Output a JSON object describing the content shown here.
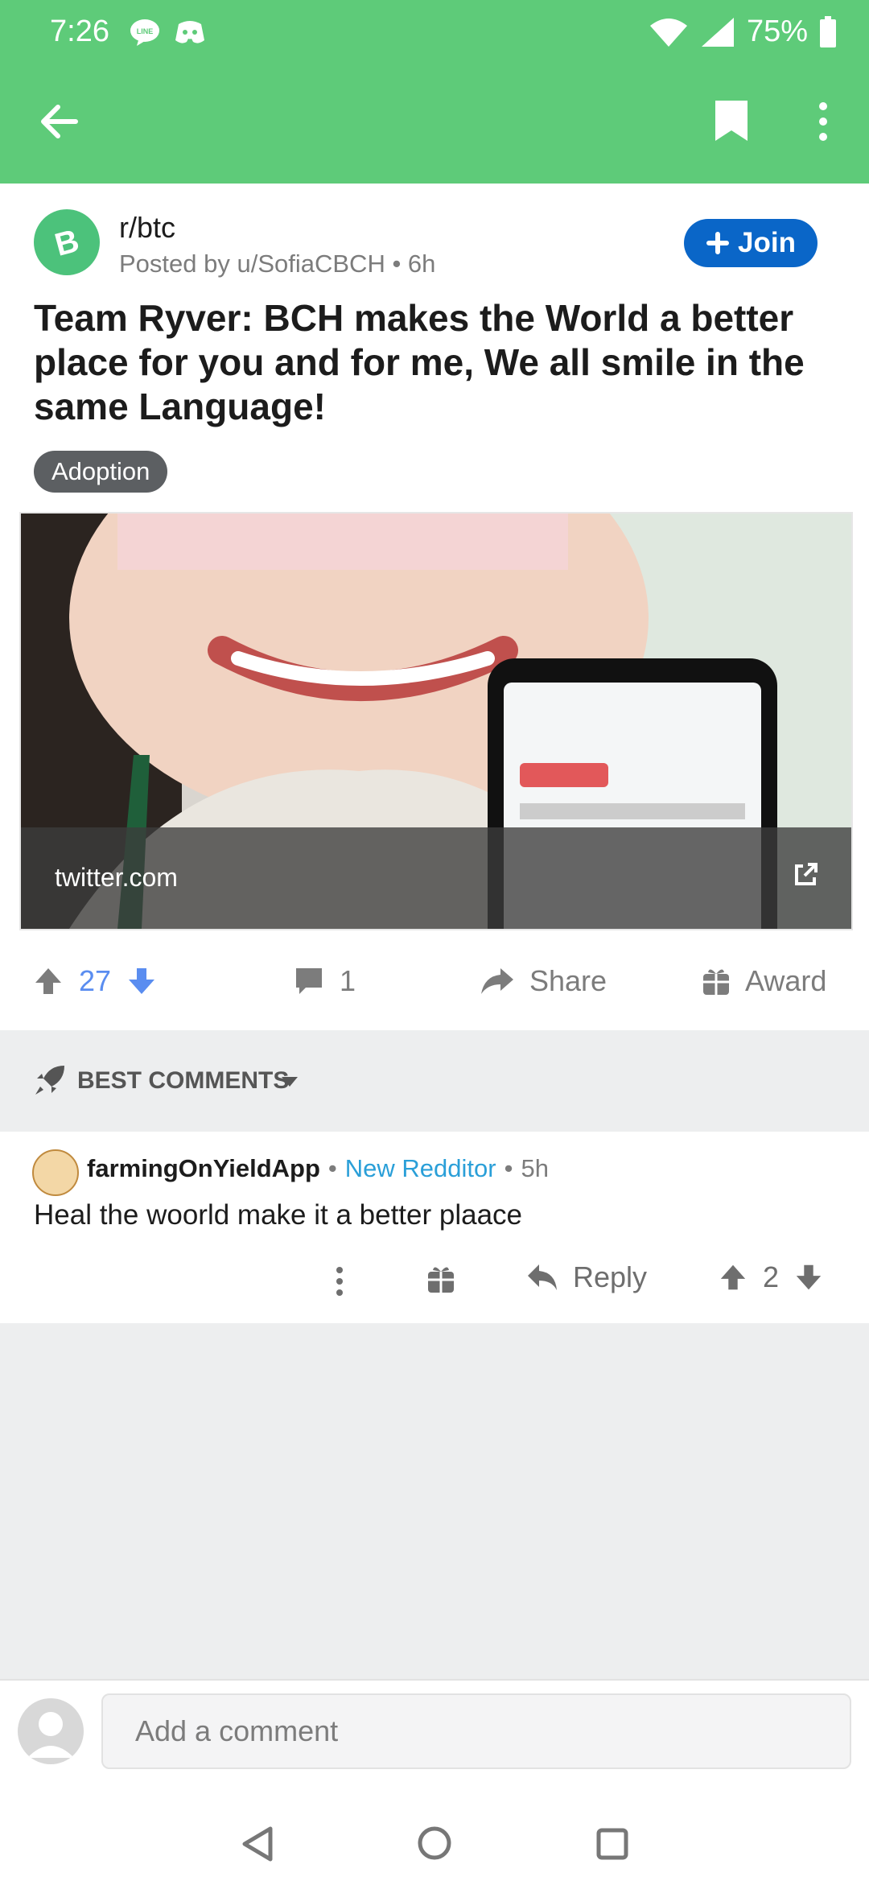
{
  "status_bar": {
    "time": "7:26",
    "battery": "75%",
    "icons": [
      "line-icon",
      "discord-icon",
      "wifi-icon",
      "signal-icon",
      "battery-icon"
    ]
  },
  "app_bar": {
    "icons": [
      "back-arrow-icon",
      "bookmark-icon",
      "more-vert-icon"
    ],
    "color": "#5ecb79"
  },
  "post": {
    "subreddit": "r/btc",
    "posted_by": "Posted by u/SofiaCBCH • 6h",
    "join_label": "Join",
    "title": "Team Ryver: BCH makes the World a better place for you and for me, We all smile in the same Language!",
    "flair": "Adoption",
    "link_domain": "twitter.com",
    "votes": "27",
    "comments": "1",
    "share_label": "Share",
    "award_label": "Award"
  },
  "comments_section": {
    "sort_label": "BEST COMMENTS"
  },
  "comment": {
    "username": "farmingOnYieldApp",
    "user_flair": "New Redditor",
    "time": "5h",
    "body": "Heal the woorld make it a better plaace",
    "reply_label": "Reply",
    "votes": "2"
  },
  "composer": {
    "placeholder": "Add a comment"
  },
  "colors": {
    "accent_green": "#5ecb79",
    "join_blue": "#0a66c8",
    "upvote_blue": "#5a8df0",
    "new_redditor": "#2a9fd8"
  }
}
